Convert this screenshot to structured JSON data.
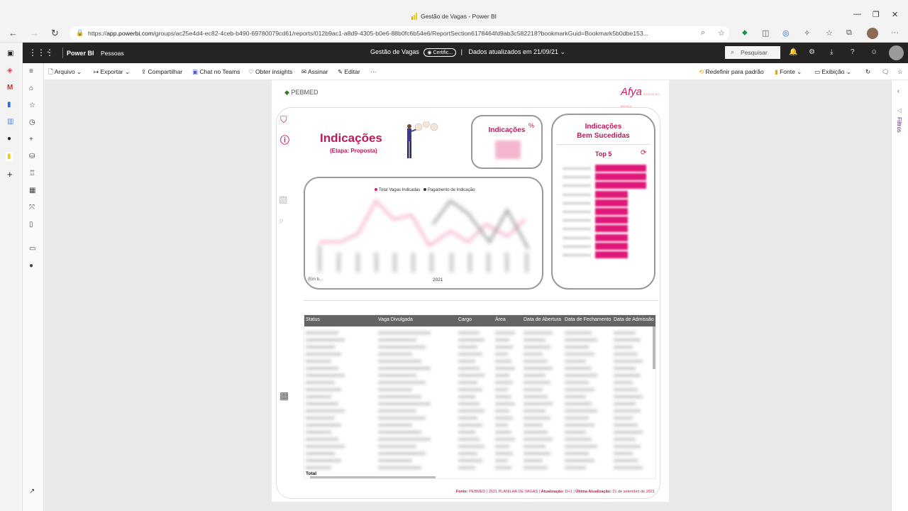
{
  "browser": {
    "window_title": "Gestão de Vagas - Power BI",
    "url_prefix": "https://",
    "url_host": "app.powerbi.com",
    "url_rest": "/groups/ac25e4d4-ec82-4ceb-b490-69780079cd61/reports/012b9ac1-a8d9-4305-b0e6-88b0fc6b54e6/ReportSection6178464fd9ab3c582218?bookmarkGuid=Bookmark5b0dbe153..."
  },
  "pbi_header": {
    "brand": "Power BI",
    "workspace": "Pessoas",
    "report_name": "Gestão de Vagas",
    "certified": "Certific...",
    "separator": "|",
    "data_updated": "Dados atualizados em 21/09/21",
    "search_placeholder": "Pesquisar"
  },
  "action_bar": {
    "arquivo": "Arquivo",
    "exportar": "Exportar",
    "compartilhar": "Compartilhar",
    "teams": "Chat no Teams",
    "insights": "Obter insights",
    "assinar": "Assinar",
    "editar": "Editar",
    "more": "···",
    "reset": "Redefinir para padrão",
    "fonte": "Fonte",
    "exibicao": "Exibição"
  },
  "filters_label": "Filtros",
  "report": {
    "pebmed_logo": "PEBMED",
    "afya_logo": "Afya",
    "afya_small": "EDUCAÇÃO MÉDICA",
    "title": "Indicações",
    "subtitle": "(Etapa: Proposta)",
    "kpi_title": "Indicações",
    "kpi_pct": "%",
    "line_chart": {
      "legend_1": "Total Vagas Indicadas",
      "legend_2": "Pagamento de Indicação",
      "x_label": "2021",
      "left_label": "(Em b...",
      "colors": {
        "series1": "#e0187a",
        "series2": "#333333"
      }
    },
    "top_card": {
      "title_line1": "Indicações",
      "title_line2": "Bem Sucedidas",
      "top5": "Top 5",
      "bar_fractions": [
        1.0,
        1.0,
        1.0,
        0.64,
        0.64,
        0.64,
        0.64,
        0.64,
        0.64,
        0.64,
        0.64
      ]
    },
    "table": {
      "headers": [
        "Status",
        "Vaga Divulgada",
        "Cargo",
        "Área",
        "Data de Abertura",
        "Data de Fechamento",
        "Data de Admissão"
      ],
      "total_label": "Total"
    },
    "footer": {
      "fonte_label": "Fonte:",
      "fonte_text": "PEBMED | 2021 PLANILHA DE VAGAS |",
      "atualizacao_label": "Atualização:",
      "atualizacao_text": "D+1 |",
      "ultima_label": "Última Atualização:",
      "ultima_text": "21 de setembro de 2021"
    }
  }
}
